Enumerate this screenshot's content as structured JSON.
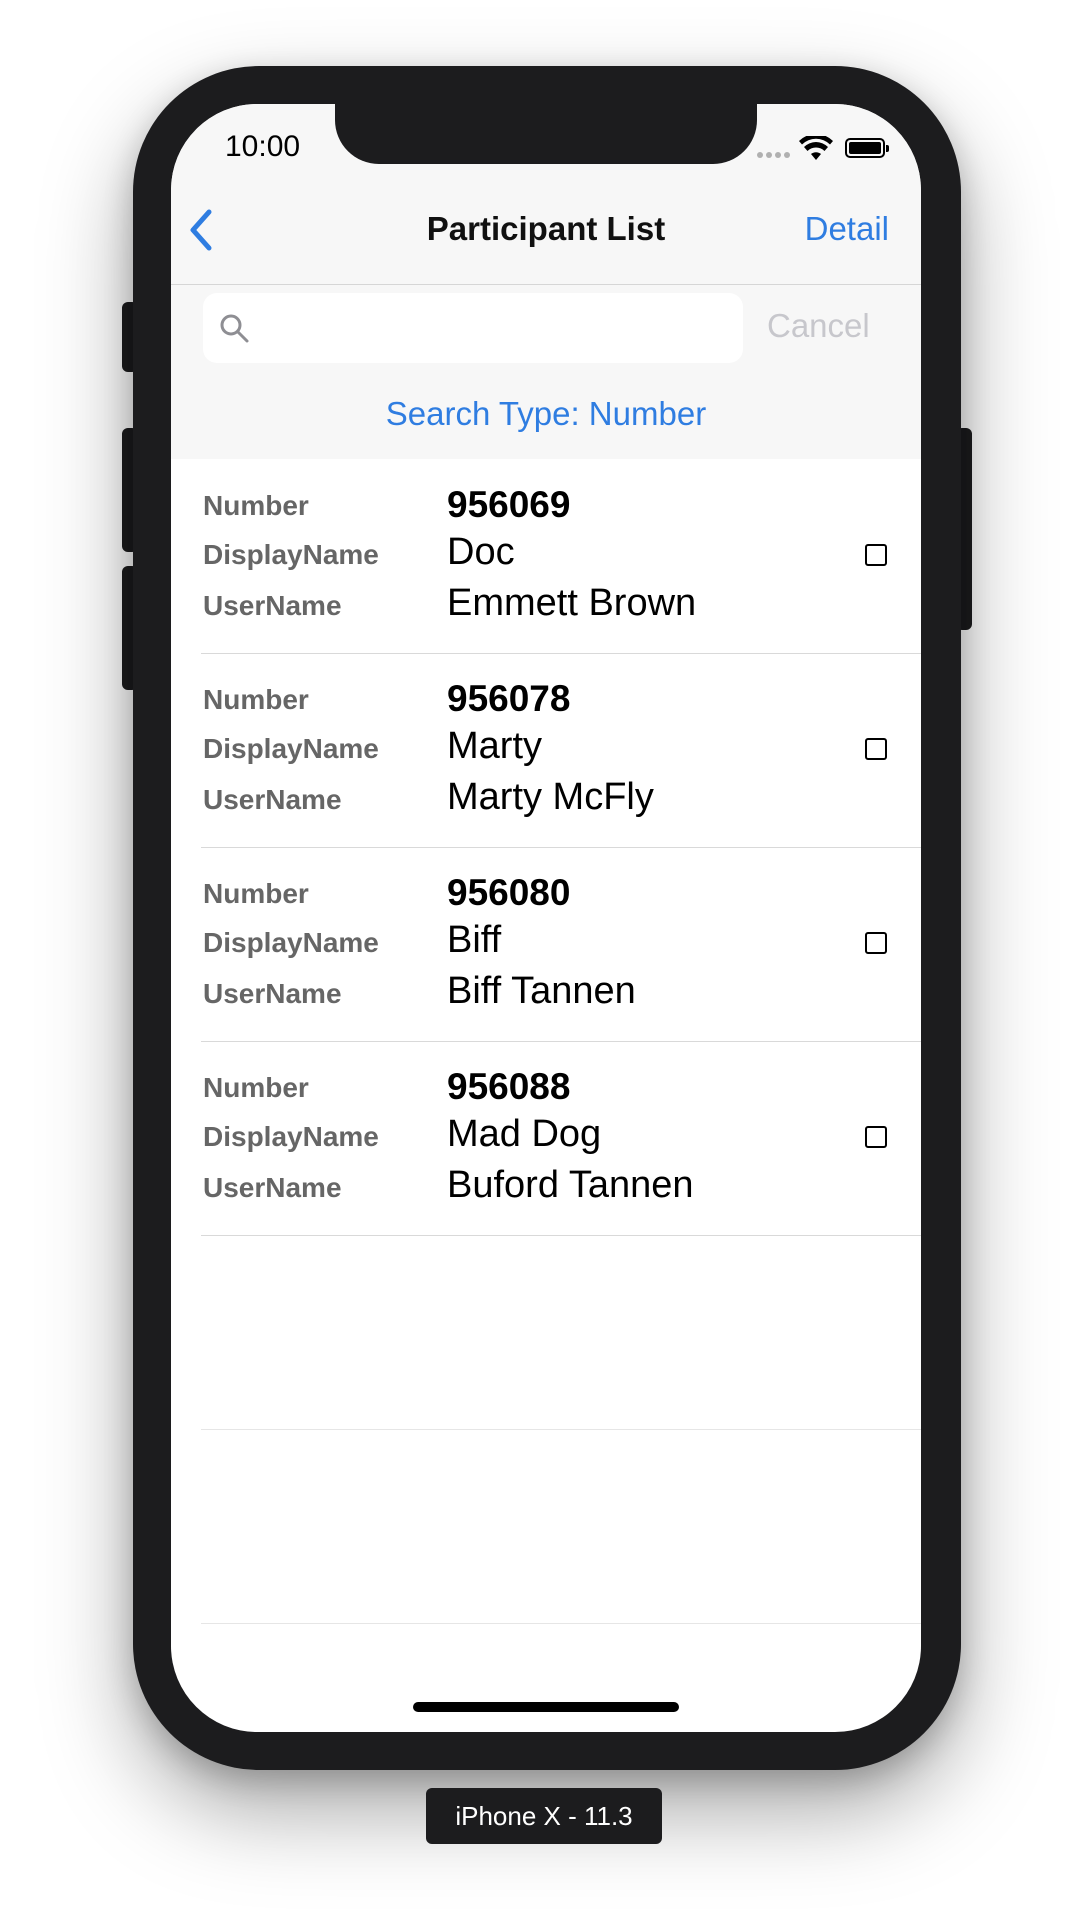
{
  "status_bar": {
    "time": "10:00"
  },
  "nav": {
    "title": "Participant List",
    "detail_label": "Detail",
    "back_icon": "chevron-left-icon"
  },
  "search": {
    "placeholder": "",
    "value": "",
    "cancel_label": "Cancel",
    "search_type_label": "Search Type: Number"
  },
  "labels": {
    "number": "Number",
    "display_name": "DisplayName",
    "user_name": "UserName"
  },
  "participants": [
    {
      "number": "956069",
      "display_name": "Doc",
      "user_name": "Emmett Brown",
      "checked": false
    },
    {
      "number": "956078",
      "display_name": "Marty",
      "user_name": "Marty McFly",
      "checked": false
    },
    {
      "number": "956080",
      "display_name": "Biff",
      "user_name": "Biff Tannen",
      "checked": false
    },
    {
      "number": "956088",
      "display_name": "Mad Dog",
      "user_name": "Buford Tannen",
      "checked": false
    }
  ],
  "device_label": "iPhone X - 11.3",
  "colors": {
    "accent": "#2f7de1",
    "bar_background": "#f7f7f7",
    "label_gray": "#666666",
    "device_frame": "#1c1c1e"
  }
}
